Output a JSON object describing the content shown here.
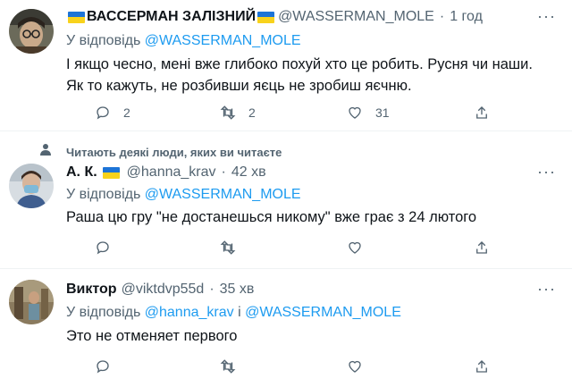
{
  "tweets": [
    {
      "name": "ВАССЕРМАН ЗАЛІЗНИЙ",
      "handle": "@WASSERMAN_MOLE",
      "time": "1 год",
      "reply_prefix": "У відповідь",
      "reply_to": "@WASSERMAN_MOLE",
      "text_lines": [
        "І якщо чесно, мені вже глибоко похуй хто це робить. Русня чи наши.",
        "Як то кажуть, не розбивши яєць не зробиш яєчню."
      ],
      "replies": "2",
      "retweets": "2",
      "likes": "31"
    },
    {
      "social_context": "Читають деякі люди, яких ви читаєте",
      "name": "А. К.",
      "handle": "@hanna_krav",
      "time": "42 хв",
      "reply_prefix": "У відповідь",
      "reply_to": "@WASSERMAN_MOLE",
      "text_lines": [
        "Раша цю гру \"не достанешься никому\" вже грає з 24 лютого"
      ],
      "replies": "",
      "retweets": "",
      "likes": ""
    },
    {
      "name": "Виктор",
      "handle": "@viktdvp55d",
      "time": "35 хв",
      "reply_prefix": "У відповідь",
      "reply_to_1": "@hanna_krav",
      "reply_and": "і",
      "reply_to_2": "@WASSERMAN_MOLE",
      "text_lines": [
        "Это не отменяет первого"
      ],
      "replies": "",
      "retweets": "",
      "likes": ""
    }
  ],
  "dot": "·",
  "more_glyph": "···",
  "colors": {
    "link": "#1d9bf0",
    "muted": "#536471",
    "flag_blue": "#1d74d7",
    "flag_yellow": "#f8d21c"
  }
}
